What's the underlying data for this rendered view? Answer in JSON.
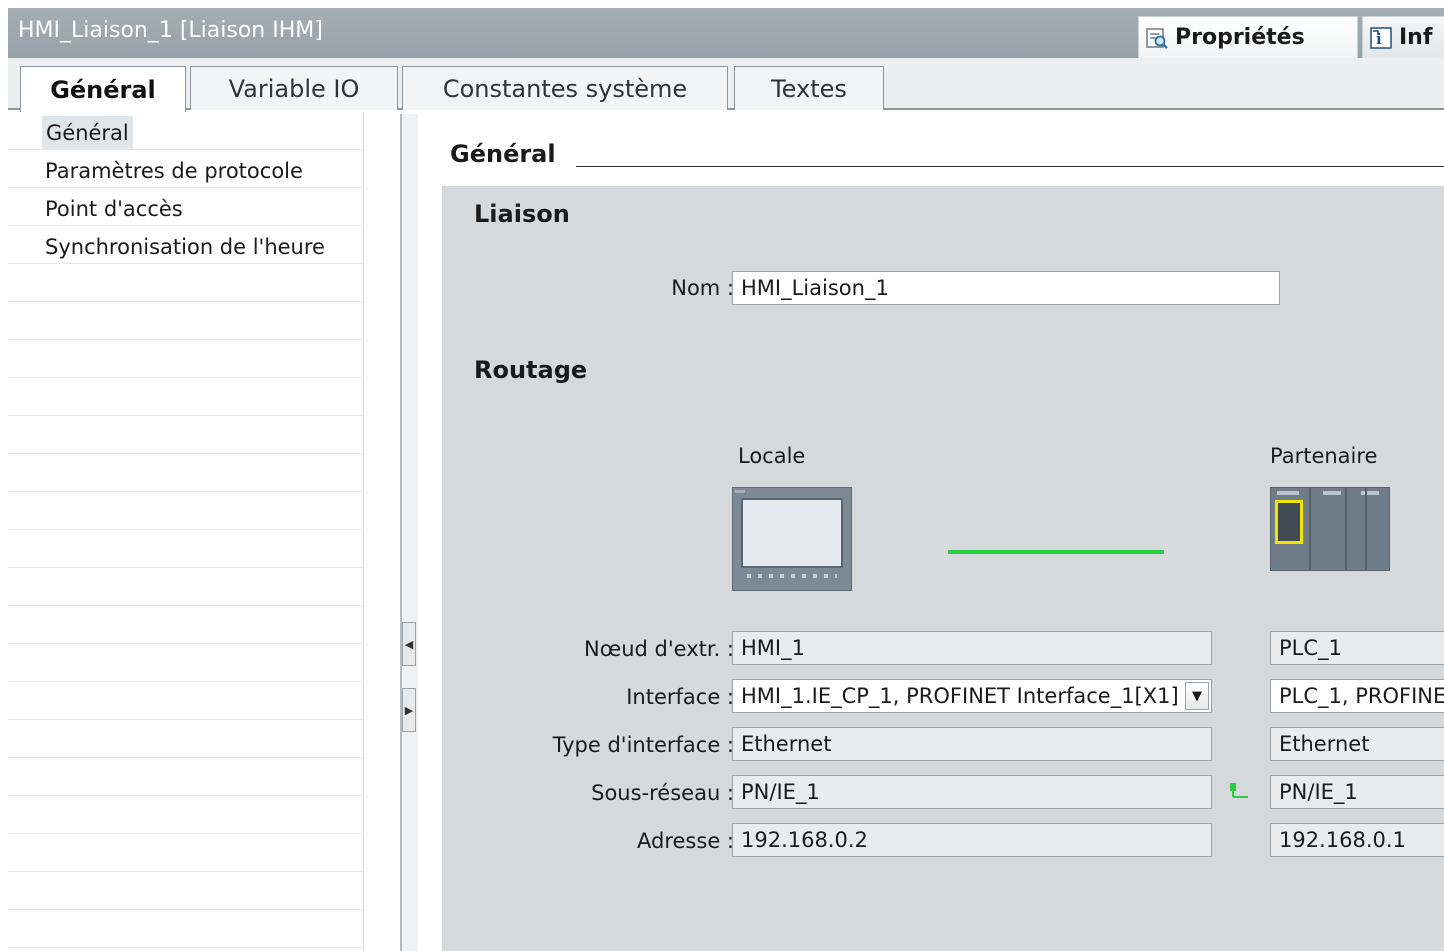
{
  "window": {
    "title": "HMI_Liaison_1 [Liaison IHM]",
    "properties_tab": "Propriétés",
    "info_tab": "Inf"
  },
  "tabs": [
    "Général",
    "Variable IO",
    "Constantes système",
    "Textes"
  ],
  "nav": {
    "items": [
      "Général",
      "Paramètres de protocole",
      "Point d'accès",
      "Synchronisation de l'heure"
    ],
    "selected": 0
  },
  "content": {
    "section_title": "Général",
    "liaison": {
      "title": "Liaison",
      "name_label": "Nom :",
      "name_value": "HMI_Liaison_1"
    },
    "routage": {
      "title": "Routage",
      "local_caption": "Locale",
      "partner_caption": "Partenaire",
      "labels": {
        "node": "Nœud d'extr. :",
        "interface": "Interface :",
        "interface_type": "Type d'interface :",
        "subnet": "Sous-réseau :",
        "address": "Adresse :"
      },
      "local": {
        "node": "HMI_1",
        "interface": "HMI_1.IE_CP_1, PROFINET Interface_1[X1]",
        "interface_type": "Ethernet",
        "subnet": "PN/IE_1",
        "address": "192.168.0.2"
      },
      "partner": {
        "node": "PLC_1",
        "interface": "PLC_1, PROFINE",
        "interface_type": "Ethernet",
        "subnet": "PN/IE_1",
        "address": "192.168.0.1"
      }
    }
  },
  "colors": {
    "link": "#2ecc40",
    "panel": "#d6d9db",
    "titlebar": "#9aa4ab",
    "plc_highlight": "#f2e600"
  },
  "icons": {
    "properties": "magnifier-properties-icon",
    "info": "info-icon",
    "dropdown": "triangle-down",
    "subnet": "network-connection-icon"
  }
}
